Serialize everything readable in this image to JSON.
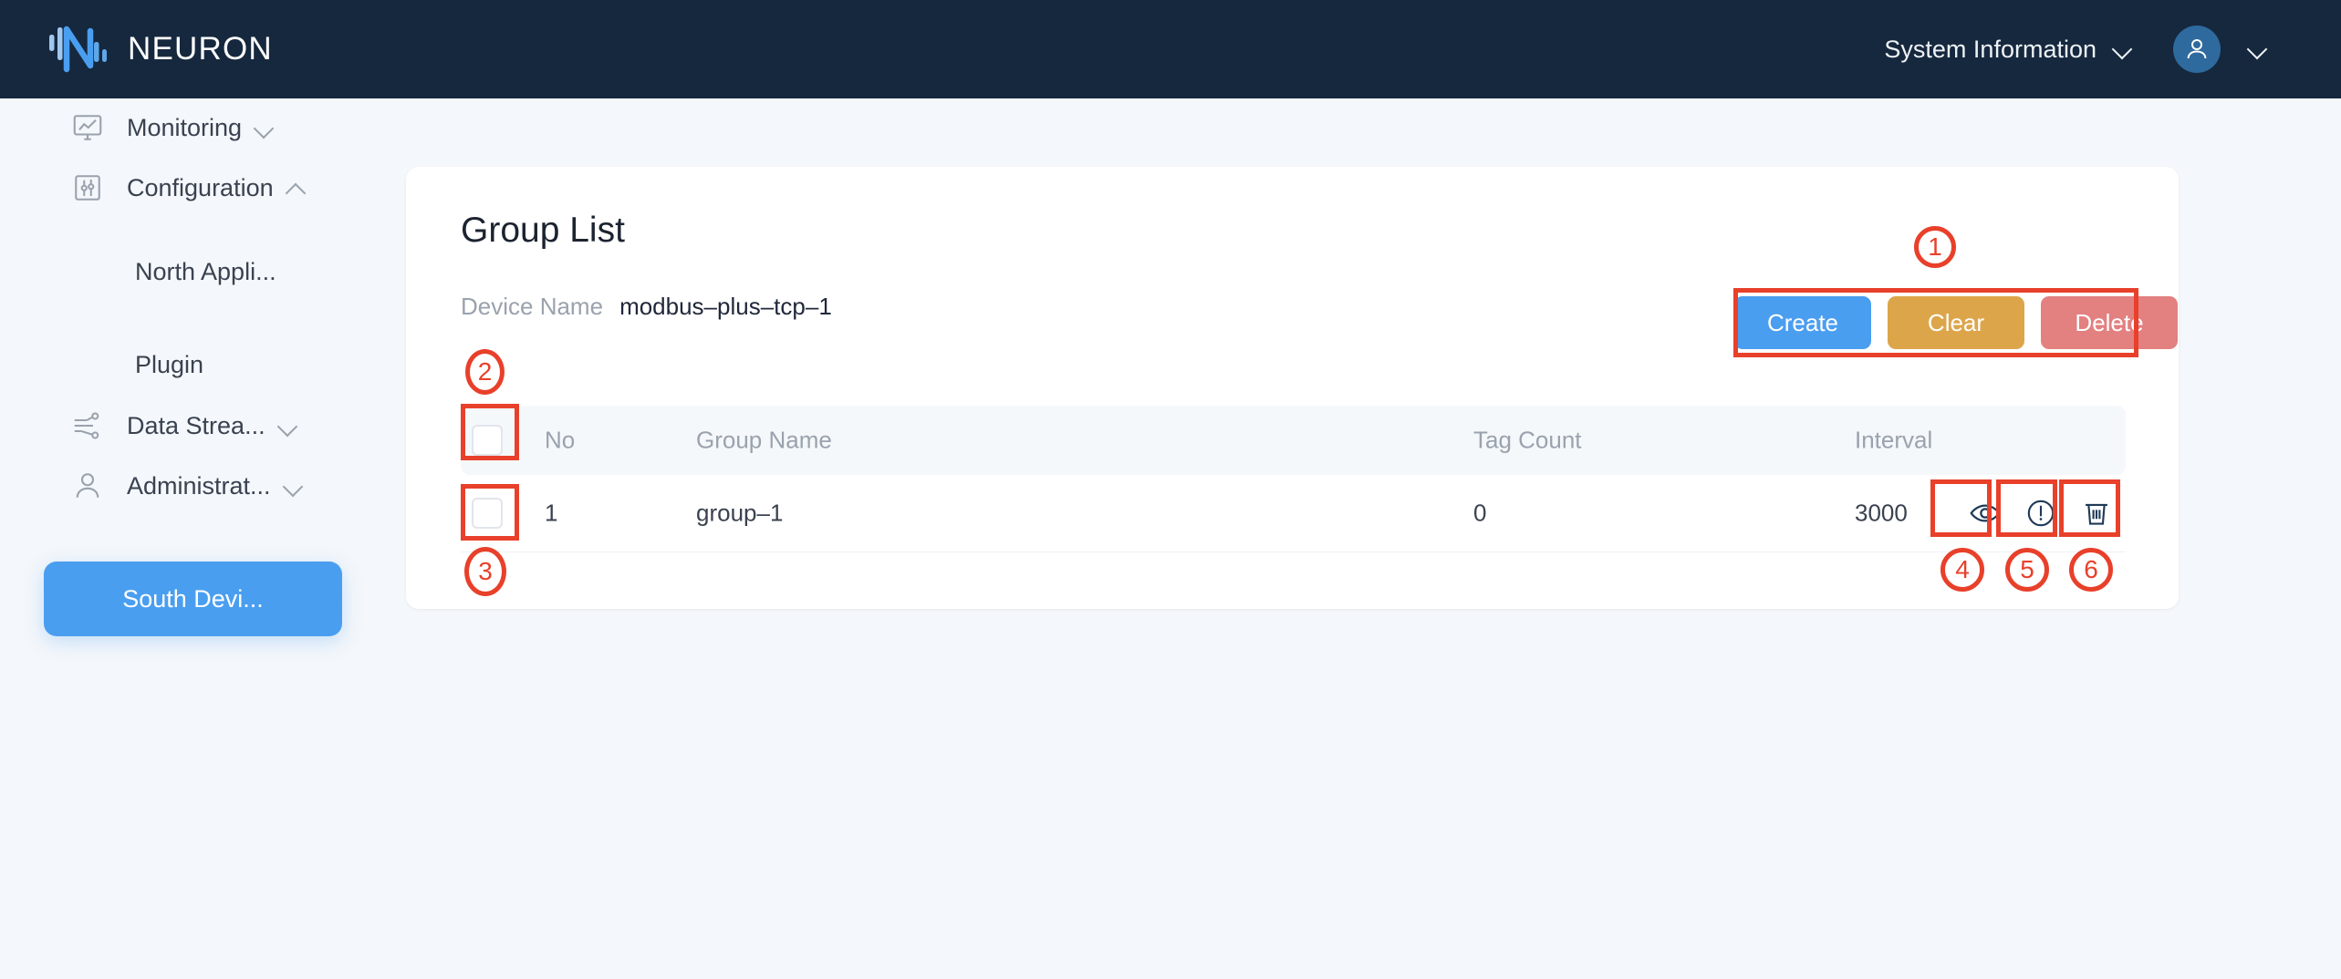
{
  "header": {
    "brand": "NEURON",
    "logo_icon": "neuron-logo-icon",
    "system_information_label": "System Information",
    "system_information_chevron": "chevron-down-icon",
    "avatar_icon": "user-avatar-icon",
    "avatar_chevron": "chevron-down-icon",
    "background_color": "#16283e",
    "brand_accent_color": "#4a9ef0"
  },
  "sidebar": {
    "items": [
      {
        "label": "Monitoring",
        "icon": "monitor-chart-icon",
        "chevron": "chevron-down-icon",
        "expanded": false,
        "active": false
      },
      {
        "label": "Configuration",
        "icon": "sliders-icon",
        "chevron": "chevron-up-icon",
        "expanded": true,
        "active": false
      }
    ],
    "sub_items": [
      {
        "label": "North Appli...",
        "active": false
      },
      {
        "label": "South Devi...",
        "active": true
      },
      {
        "label": "Plugin",
        "active": false
      }
    ],
    "items_bottom": [
      {
        "label": "Data Strea...",
        "icon": "data-stream-icon",
        "chevron": "chevron-down-icon"
      },
      {
        "label": "Administrat...",
        "icon": "user-outline-icon",
        "chevron": "chevron-down-icon"
      }
    ],
    "active_color": "#4a9ef0"
  },
  "main": {
    "title": "Group List",
    "device_name_label": "Device Name",
    "device_name_value": "modbus–plus–tcp–1",
    "buttons": [
      {
        "label": "Create",
        "color": "#4a9ef0"
      },
      {
        "label": "Clear",
        "color": "#dda54a"
      },
      {
        "label": "Delete",
        "color": "#e38080"
      }
    ],
    "table": {
      "columns": [
        "No",
        "Group Name",
        "Tag Count",
        "Interval"
      ],
      "rows": [
        {
          "no": "1",
          "group_name": "group–1",
          "tag_count": "0",
          "interval": "3000"
        }
      ],
      "row_actions": [
        {
          "name": "view-icon",
          "title": "View"
        },
        {
          "name": "alert-icon",
          "title": "Info"
        },
        {
          "name": "trash-icon",
          "title": "Delete"
        }
      ],
      "header_checkbox_checked": false,
      "row_checkbox_checked": false
    }
  },
  "annotations": {
    "color": "#e8402a",
    "markers": [
      {
        "number": "1",
        "target": "action-buttons"
      },
      {
        "number": "2",
        "target": "header-select-all-checkbox"
      },
      {
        "number": "3",
        "target": "row-checkbox"
      },
      {
        "number": "4",
        "target": "view-icon"
      },
      {
        "number": "5",
        "target": "alert-icon"
      },
      {
        "number": "6",
        "target": "trash-icon"
      }
    ]
  }
}
